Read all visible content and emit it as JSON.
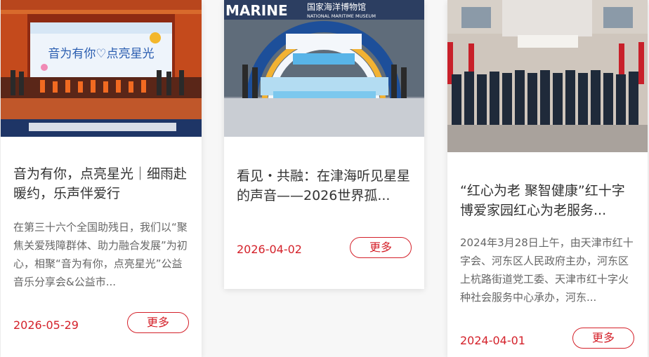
{
  "accent": "#d4212a",
  "cards": [
    {
      "photo_banner": "音为有你♡点亮星光",
      "title": "音为有你，点亮星光｜细雨赴暖约，乐声伴爱行",
      "summary": "在第三十六个全国助残日，我们以“聚焦关爱残障群体、助力融合发展”为初心，相聚“音为有你，点亮星光”公益音乐分享会&公益市...",
      "date": "2026-05-29",
      "more_label": "更多"
    },
    {
      "photo_sign_en": "MARINE",
      "photo_sign_cn": "国家海洋博物馆",
      "photo_sign_sub": "NATIONAL MARITIME MUSEUM",
      "title": "看见・共融：在津海听见星星的声音——2026世界孤...",
      "date": "2026-04-02",
      "more_label": "更多"
    },
    {
      "title": "“红心为老 聚智健康”红十字博爱家园红心为老服务...",
      "summary": "2024年3月28日上午，由天津市红十字会、河东区人民政府主办，河东区上杭路街道党工委、天津市红十字火种社会服务中心承办，河东...",
      "date": "2024-04-01",
      "more_label": "更多"
    }
  ]
}
